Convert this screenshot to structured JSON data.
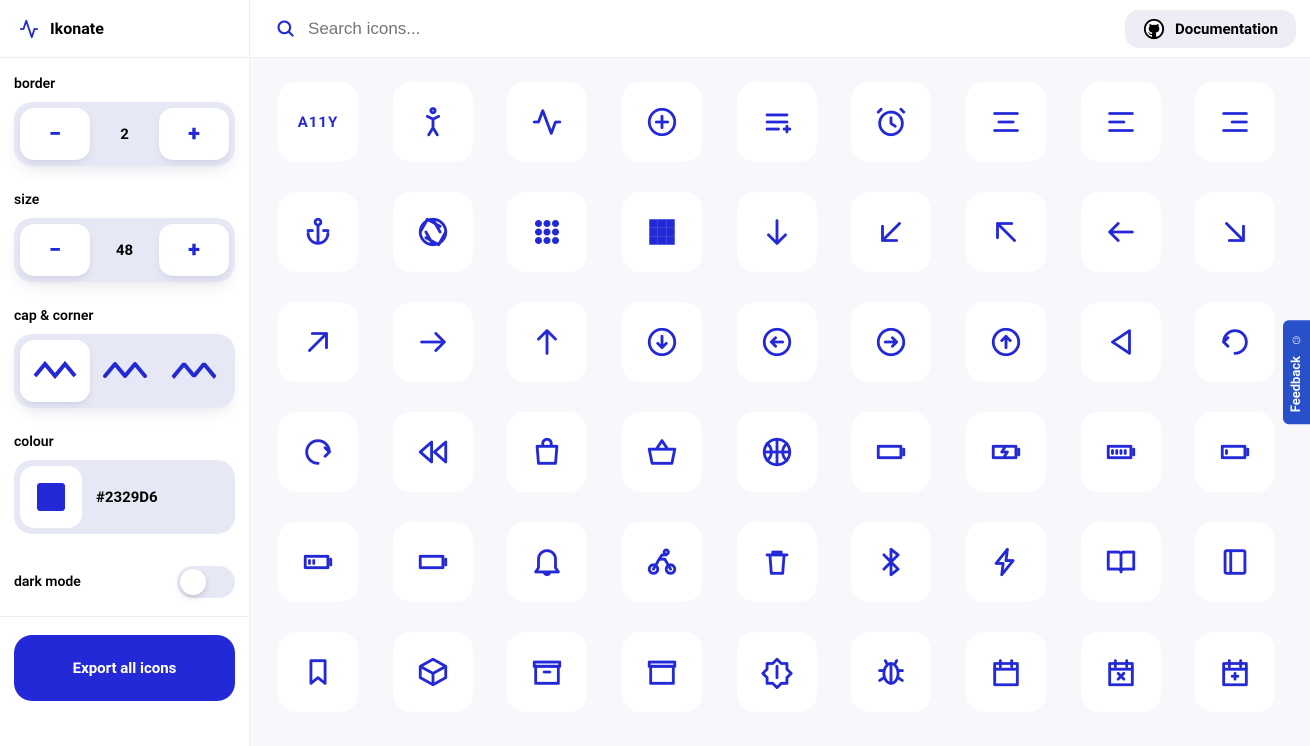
{
  "app": {
    "name": "Ikonate"
  },
  "search": {
    "placeholder": "Search icons..."
  },
  "header": {
    "doc_label": "Documentation"
  },
  "sidebar": {
    "border_label": "border",
    "border_value": "2",
    "size_label": "size",
    "size_value": "48",
    "cap_label": "cap & corner",
    "colour_label": "colour",
    "colour_value": "#2329D6",
    "dark_label": "dark mode",
    "export_label": "Export all icons"
  },
  "feedback": {
    "label": "Feedback"
  },
  "accent": "#2329D6",
  "icons": [
    [
      "a11y",
      "accessibility-person",
      "activity",
      "add-circle",
      "add-to-list",
      "alarm",
      "align-center",
      "align-left",
      "align-right"
    ],
    [
      "anchor",
      "aperture",
      "apps-dots",
      "apps-grid",
      "arrow-down",
      "arrow-down-left",
      "arrow-up-left",
      "arrow-left",
      "arrow-down-right"
    ],
    [
      "arrow-up-right",
      "arrow-right",
      "arrow-up",
      "arrow-down-circle",
      "arrow-left-circle",
      "arrow-right-circle",
      "arrow-up-circle",
      "back-triangle",
      "undo"
    ],
    [
      "redo",
      "rewind",
      "bag",
      "basket",
      "basketball",
      "battery-empty",
      "battery-charging",
      "battery-full",
      "battery-low"
    ],
    [
      "battery-medium",
      "battery",
      "bell",
      "bike",
      "bin",
      "bluetooth",
      "bolt",
      "book-open",
      "book"
    ],
    [
      "bookmark",
      "box",
      "box-storage",
      "box-alt",
      "brightness",
      "bug",
      "calendar",
      "calendar-x",
      "calendar-add"
    ]
  ]
}
